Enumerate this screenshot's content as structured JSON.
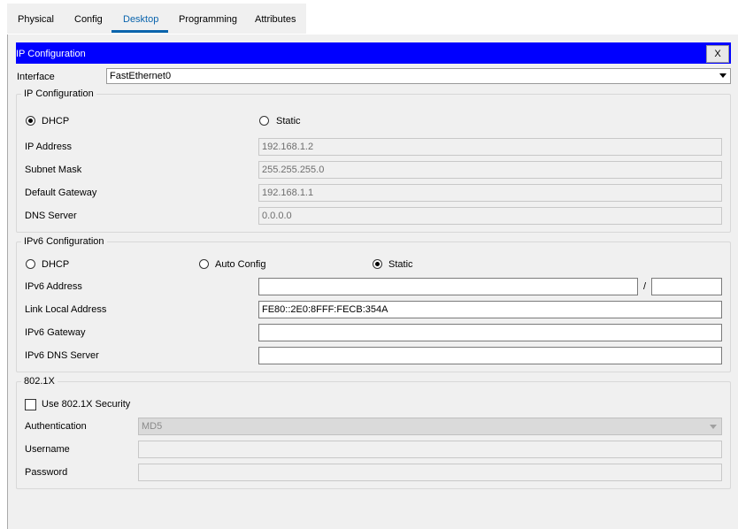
{
  "tabs": [
    {
      "label": "Physical"
    },
    {
      "label": "Config"
    },
    {
      "label": "Desktop",
      "active": true
    },
    {
      "label": "Programming"
    },
    {
      "label": "Attributes"
    }
  ],
  "window": {
    "title": "IP Configuration",
    "close_label": "X"
  },
  "interface": {
    "label": "Interface",
    "value": "FastEthernet0"
  },
  "ipv4": {
    "legend": "IP Configuration",
    "dhcp_label": "DHCP",
    "static_label": "Static",
    "selected": "DHCP",
    "ip_label": "IP Address",
    "ip_value": "192.168.1.2",
    "mask_label": "Subnet Mask",
    "mask_value": "255.255.255.0",
    "gateway_label": "Default Gateway",
    "gateway_value": "192.168.1.1",
    "dns_label": "DNS Server",
    "dns_value": "0.0.0.0"
  },
  "ipv6": {
    "legend": "IPv6 Configuration",
    "dhcp_label": "DHCP",
    "auto_label": "Auto Config",
    "static_label": "Static",
    "selected": "Static",
    "address_label": "IPv6 Address",
    "address_value": "",
    "prefix_sep": "/",
    "prefix_value": "",
    "link_local_label": "Link Local Address",
    "link_local_value": "FE80::2E0:8FFF:FECB:354A",
    "gateway_label": "IPv6 Gateway",
    "gateway_value": "",
    "dns_label": "IPv6 DNS Server",
    "dns_value": ""
  },
  "dot1x": {
    "legend": "802.1X",
    "use_security_label": "Use 802.1X Security",
    "use_security_checked": false,
    "auth_label": "Authentication",
    "auth_value": "MD5",
    "username_label": "Username",
    "username_value": "",
    "password_label": "Password",
    "password_value": ""
  },
  "colors": {
    "titlebar": "#0000ff",
    "active_tab": "#0a64ad",
    "panel_bg": "#f0f0f0"
  }
}
